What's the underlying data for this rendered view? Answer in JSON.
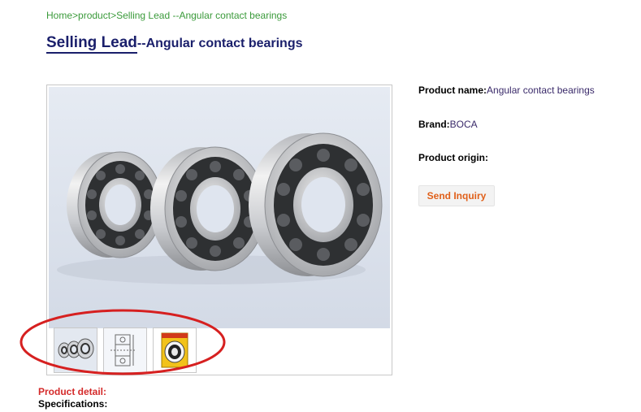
{
  "breadcrumb": {
    "home": "Home",
    "sep1": ">",
    "product": "product",
    "sep2": ">",
    "current": "Selling Lead --Angular contact bearings"
  },
  "title": {
    "lead": "Selling Lead",
    "rest": "--Angular contact bearings"
  },
  "product_info": {
    "name_label": "Product name:",
    "name_value": "Angular contact bearings",
    "brand_label": "Brand:",
    "brand_value": "BOCA",
    "origin_label": "Product origin:",
    "origin_value": ""
  },
  "actions": {
    "send_inquiry": "Send Inquiry"
  },
  "sections": {
    "detail": "Product detail:",
    "specifications": "Specifications:"
  },
  "colors": {
    "breadcrumb": "#3a9a3a",
    "title": "#1a1f6b",
    "accent_orange": "#e0601a",
    "annotation_red": "#d62020",
    "detail_red": "#d42a2a"
  }
}
